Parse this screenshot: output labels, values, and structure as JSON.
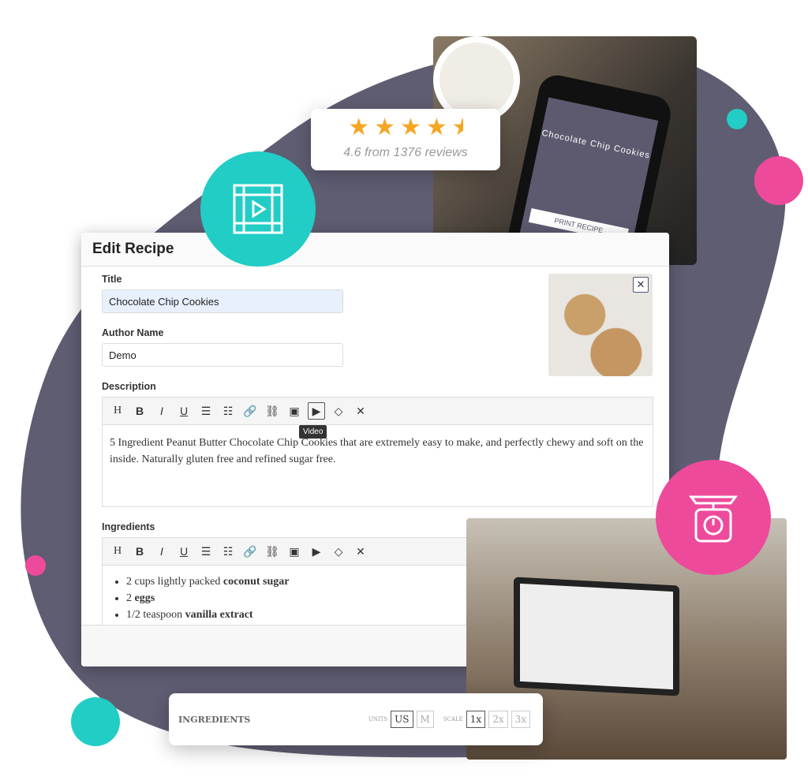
{
  "colors": {
    "blob": "#5f5d72",
    "teal": "#22cdc6",
    "pink": "#ee4a9b",
    "star": "#f5a623"
  },
  "rating": {
    "stars": 4.6,
    "text": "4.6 from 1376 reviews"
  },
  "phone": {
    "recipe_title": "Chocolate Chip Cookies",
    "print_label": "PRINT RECIPE"
  },
  "editor": {
    "title": "Edit Recipe",
    "title_label": "Title",
    "title_value": "Chocolate Chip Cookies",
    "author_label": "Author Name",
    "author_value": "Demo",
    "description_label": "Description",
    "toolbar": [
      "H",
      "B",
      "I",
      "U",
      "bulleted-list",
      "numbered-list",
      "link",
      "unlink",
      "image",
      "video",
      "eraser",
      "fullscreen"
    ],
    "tooltip": "Video",
    "description_text": "5 Ingredient Peanut Butter Chocolate Chip Cookies that are extremely easy to make, and perfectly chewy and soft on the inside. Naturally gluten free and refined sugar free.",
    "ingredients_label": "Ingredients",
    "ingredients": [
      {
        "plain": "2 cups lightly packed ",
        "bold": "coconut sugar"
      },
      {
        "plain": "2 ",
        "bold": "eggs"
      },
      {
        "plain": "1/2 teaspoon ",
        "bold": "vanilla extract"
      }
    ]
  },
  "ingredients_card": {
    "title": "INGREDIENTS",
    "units_label": "UNITS",
    "units": [
      "US",
      "M"
    ],
    "units_selected": "US",
    "scale_label": "SCALE",
    "scales": [
      "1x",
      "2x",
      "3x"
    ],
    "scale_selected": "1x"
  }
}
